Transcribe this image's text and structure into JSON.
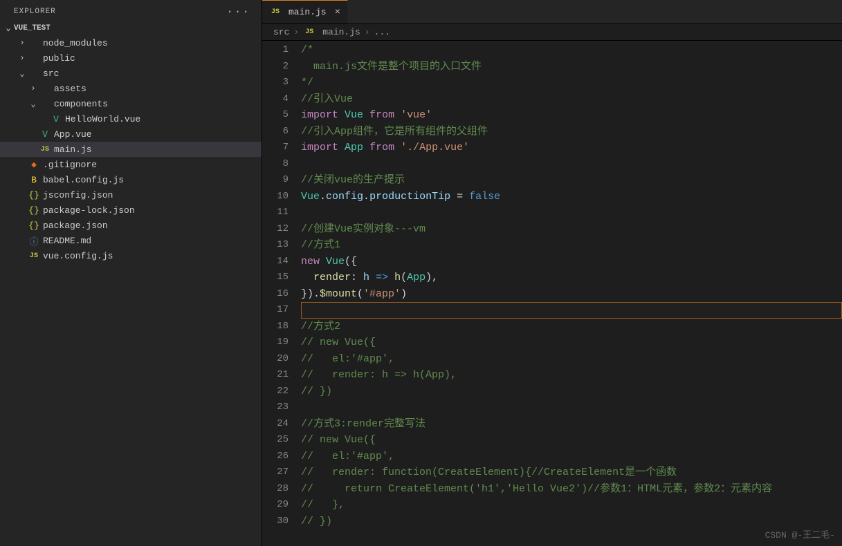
{
  "sidebar": {
    "title": "EXPLORER",
    "more": "···",
    "root": "VUE_TEST",
    "tree": [
      {
        "indent": 1,
        "chev": "›",
        "icon": "",
        "iconClass": "",
        "label": "node_modules",
        "sel": false
      },
      {
        "indent": 1,
        "chev": "›",
        "icon": "",
        "iconClass": "",
        "label": "public",
        "sel": false
      },
      {
        "indent": 1,
        "chev": "⌄",
        "icon": "",
        "iconClass": "",
        "label": "src",
        "sel": false
      },
      {
        "indent": 2,
        "chev": "›",
        "icon": "",
        "iconClass": "",
        "label": "assets",
        "sel": false
      },
      {
        "indent": 2,
        "chev": "⌄",
        "icon": "",
        "iconClass": "",
        "label": "components",
        "sel": false
      },
      {
        "indent": 3,
        "chev": "",
        "icon": "V",
        "iconClass": "ic-vue",
        "label": "HelloWorld.vue",
        "sel": false
      },
      {
        "indent": 2,
        "chev": "",
        "icon": "V",
        "iconClass": "ic-vue",
        "label": "App.vue",
        "sel": false
      },
      {
        "indent": 2,
        "chev": "",
        "icon": "JS",
        "iconClass": "ic-js",
        "label": "main.js",
        "sel": true
      },
      {
        "indent": 1,
        "chev": "",
        "icon": "◆",
        "iconClass": "ic-git",
        "label": ".gitignore",
        "sel": false
      },
      {
        "indent": 1,
        "chev": "",
        "icon": "B",
        "iconClass": "ic-babel",
        "label": "babel.config.js",
        "sel": false
      },
      {
        "indent": 1,
        "chev": "",
        "icon": "{}",
        "iconClass": "ic-json",
        "label": "jsconfig.json",
        "sel": false
      },
      {
        "indent": 1,
        "chev": "",
        "icon": "{}",
        "iconClass": "ic-json",
        "label": "package-lock.json",
        "sel": false
      },
      {
        "indent": 1,
        "chev": "",
        "icon": "{}",
        "iconClass": "ic-json",
        "label": "package.json",
        "sel": false
      },
      {
        "indent": 1,
        "chev": "",
        "icon": "ⓘ",
        "iconClass": "ic-info",
        "label": "README.md",
        "sel": false
      },
      {
        "indent": 1,
        "chev": "",
        "icon": "JS",
        "iconClass": "ic-js",
        "label": "vue.config.js",
        "sel": false
      }
    ]
  },
  "tab": {
    "icon": "JS",
    "label": "main.js",
    "close": "×"
  },
  "breadcrumb": {
    "seg1": "src",
    "seg2": "main.js",
    "seg3": "...",
    "icon": "JS"
  },
  "cursorLine": 17,
  "code": [
    [
      {
        "c": "c-comment",
        "t": "/*"
      }
    ],
    [
      {
        "c": "c-punc",
        "t": "  "
      },
      {
        "c": "c-comment",
        "t": "main.js文件是整个项目的入口文件"
      }
    ],
    [
      {
        "c": "c-comment",
        "t": "*/"
      }
    ],
    [
      {
        "c": "c-comment",
        "t": "//引入Vue"
      }
    ],
    [
      {
        "c": "c-keyword",
        "t": "import"
      },
      {
        "c": "c-punc",
        "t": " "
      },
      {
        "c": "c-class",
        "t": "Vue"
      },
      {
        "c": "c-punc",
        "t": " "
      },
      {
        "c": "c-keyword",
        "t": "from"
      },
      {
        "c": "c-punc",
        "t": " "
      },
      {
        "c": "c-string",
        "t": "'vue'"
      }
    ],
    [
      {
        "c": "c-comment",
        "t": "//引入App组件，它是所有组件的父组件"
      }
    ],
    [
      {
        "c": "c-keyword",
        "t": "import"
      },
      {
        "c": "c-punc",
        "t": " "
      },
      {
        "c": "c-class",
        "t": "App"
      },
      {
        "c": "c-punc",
        "t": " "
      },
      {
        "c": "c-keyword",
        "t": "from"
      },
      {
        "c": "c-punc",
        "t": " "
      },
      {
        "c": "c-string",
        "t": "'./App.vue'"
      }
    ],
    [],
    [
      {
        "c": "c-comment",
        "t": "//关闭vue的生产提示"
      }
    ],
    [
      {
        "c": "c-class",
        "t": "Vue"
      },
      {
        "c": "c-punc",
        "t": "."
      },
      {
        "c": "c-prop",
        "t": "config"
      },
      {
        "c": "c-punc",
        "t": "."
      },
      {
        "c": "c-prop",
        "t": "productionTip"
      },
      {
        "c": "c-punc",
        "t": " = "
      },
      {
        "c": "c-const",
        "t": "false"
      }
    ],
    [],
    [
      {
        "c": "c-comment",
        "t": "//创建Vue实例对象---vm"
      }
    ],
    [
      {
        "c": "c-comment",
        "t": "//方式1"
      }
    ],
    [
      {
        "c": "c-keyword",
        "t": "new"
      },
      {
        "c": "c-punc",
        "t": " "
      },
      {
        "c": "c-class",
        "t": "Vue"
      },
      {
        "c": "c-punc",
        "t": "({"
      }
    ],
    [
      {
        "c": "c-punc",
        "t": "  "
      },
      {
        "c": "c-func",
        "t": "render"
      },
      {
        "c": "c-punc",
        "t": ": "
      },
      {
        "c": "c-var",
        "t": "h"
      },
      {
        "c": "c-punc",
        "t": " "
      },
      {
        "c": "c-const",
        "t": "=>"
      },
      {
        "c": "c-punc",
        "t": " "
      },
      {
        "c": "c-func",
        "t": "h"
      },
      {
        "c": "c-punc",
        "t": "("
      },
      {
        "c": "c-class",
        "t": "App"
      },
      {
        "c": "c-punc",
        "t": "),"
      }
    ],
    [
      {
        "c": "c-punc",
        "t": "})."
      },
      {
        "c": "c-func",
        "t": "$mount"
      },
      {
        "c": "c-punc",
        "t": "("
      },
      {
        "c": "c-string",
        "t": "'#app'"
      },
      {
        "c": "c-punc",
        "t": ")"
      }
    ],
    [],
    [
      {
        "c": "c-comment",
        "t": "//方式2"
      }
    ],
    [
      {
        "c": "c-comment",
        "t": "// new Vue({"
      }
    ],
    [
      {
        "c": "c-comment",
        "t": "//   el:'#app',"
      }
    ],
    [
      {
        "c": "c-comment",
        "t": "//   render: h => h(App),"
      }
    ],
    [
      {
        "c": "c-comment",
        "t": "// })"
      }
    ],
    [],
    [
      {
        "c": "c-comment",
        "t": "//方式3:render完整写法"
      }
    ],
    [
      {
        "c": "c-comment",
        "t": "// new Vue({"
      }
    ],
    [
      {
        "c": "c-comment",
        "t": "//   el:'#app',"
      }
    ],
    [
      {
        "c": "c-comment",
        "t": "//   render: function(CreateElement){//CreateElement是一个函数"
      }
    ],
    [
      {
        "c": "c-comment",
        "t": "//     return CreateElement('h1','Hello Vue2')//参数1：HTML元素，参数2：元素内容"
      }
    ],
    [
      {
        "c": "c-comment",
        "t": "//   },"
      }
    ],
    [
      {
        "c": "c-comment",
        "t": "// })"
      }
    ]
  ],
  "watermark": "CSDN @-王二毛-"
}
